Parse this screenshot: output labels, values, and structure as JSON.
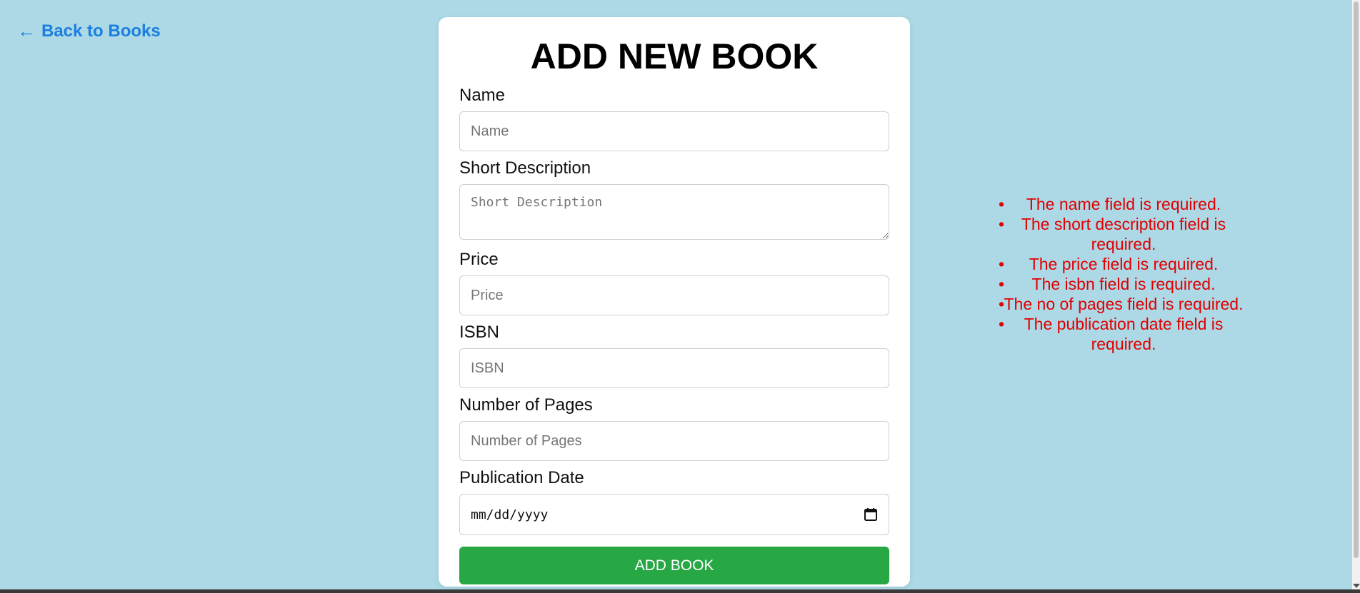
{
  "nav": {
    "back_arrow": "←",
    "back_label": "Back to Books"
  },
  "form": {
    "title": "ADD NEW BOOK",
    "fields": {
      "name": {
        "label": "Name",
        "placeholder": "Name"
      },
      "short_description": {
        "label": "Short Description",
        "placeholder": "Short Description"
      },
      "price": {
        "label": "Price",
        "placeholder": "Price"
      },
      "isbn": {
        "label": "ISBN",
        "placeholder": "ISBN"
      },
      "pages": {
        "label": "Number of Pages",
        "placeholder": "Number of Pages"
      },
      "publication_date": {
        "label": "Publication Date",
        "value": "mm/dd/yyyy",
        "icon": "calendar-icon"
      }
    },
    "submit_label": "ADD BOOK"
  },
  "errors": [
    "The name field is required.",
    "The short description field is required.",
    "The price field is required.",
    "The isbn field is required.",
    "The no of pages field is required.",
    "The publication date field is required."
  ],
  "colors": {
    "page_background": "#add8e6",
    "link": "#1a7fe0",
    "submit_button": "#28a745",
    "error_text": "#e00000"
  }
}
